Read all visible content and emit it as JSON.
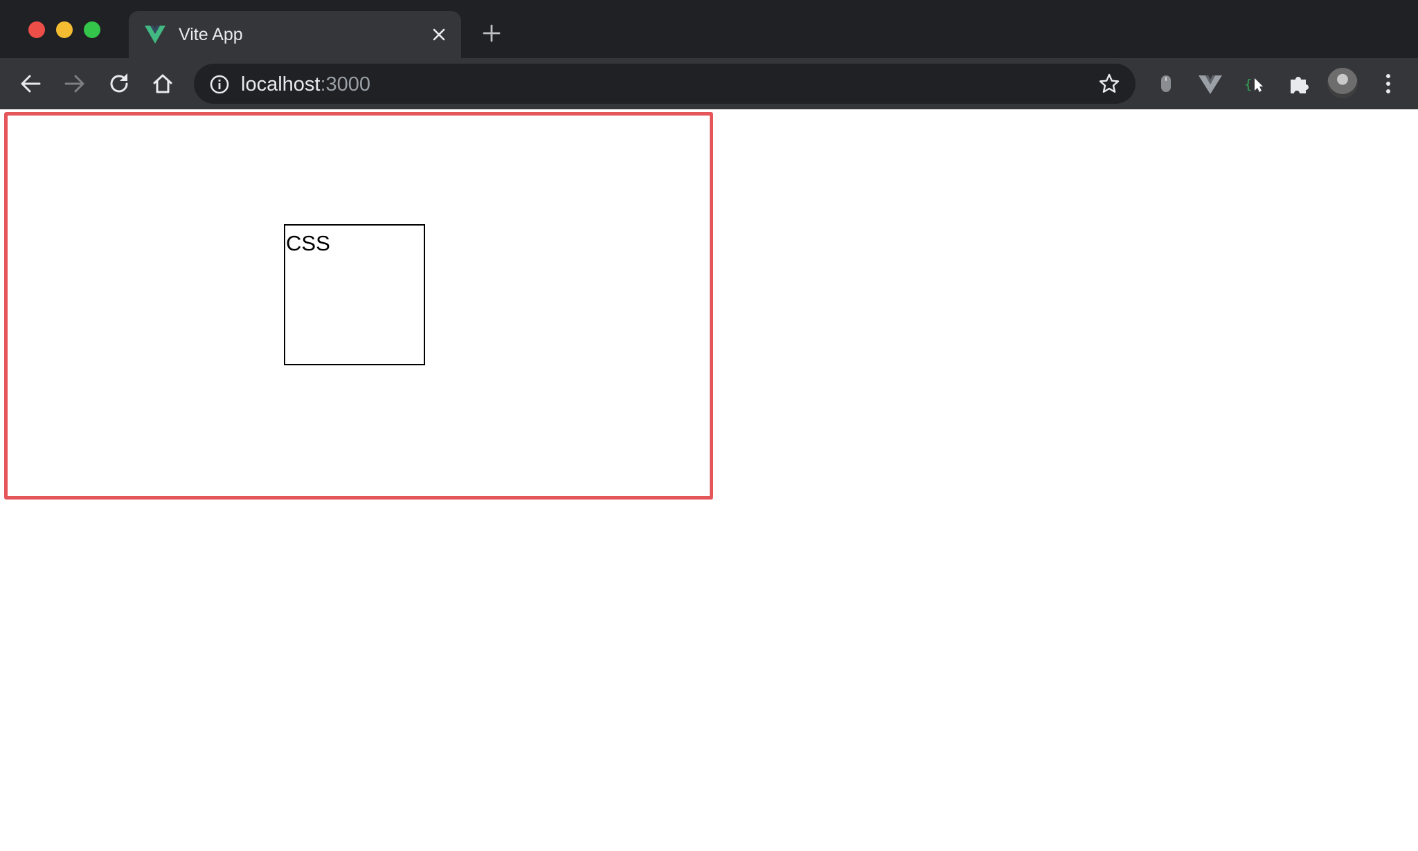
{
  "browser": {
    "tab": {
      "title": "Vite App",
      "favicon": "vue-logo-icon"
    },
    "address_bar": {
      "host": "localhost",
      "port": ":3000"
    },
    "colors": {
      "frame": "#202124",
      "toolbar": "#35363a",
      "highlight_border": "#e5565a",
      "vue_green": "#42b883"
    }
  },
  "page": {
    "box_label": "CSS"
  }
}
